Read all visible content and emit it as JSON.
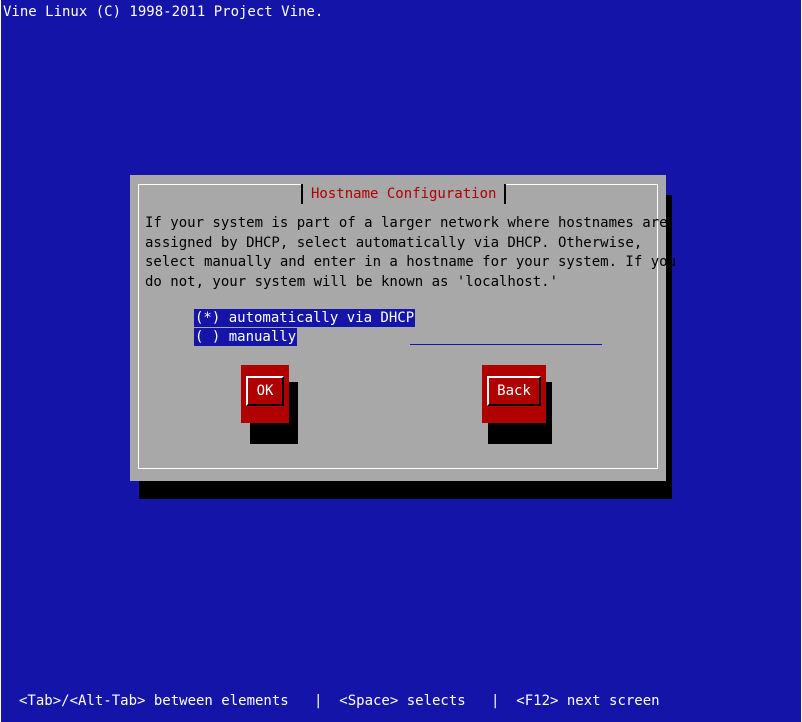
{
  "header": {
    "title": "Vine Linux (C) 1998-2011 Project Vine."
  },
  "dialog": {
    "title": "Hostname Configuration",
    "body": "If your system is part of a larger network where hostnames are\nassigned by DHCP, select automatically via DHCP. Otherwise,\nselect manually and enter in a hostname for your system. If you\ndo not, your system will be known as 'localhost.'",
    "options": [
      {
        "label": "(*) automatically via DHCP",
        "selected": true
      },
      {
        "label": "( ) manually",
        "selected": false
      }
    ],
    "hostname_value": "",
    "ok_label": "OK",
    "back_label": "Back"
  },
  "footer": {
    "help": "<Tab>/<Alt-Tab> between elements   |  <Space> selects   |  <F12> next screen"
  },
  "colors": {
    "background": "#1414a8",
    "dialog": "#a8a8a8",
    "accent": "#b00000",
    "shadow": "#000000"
  }
}
